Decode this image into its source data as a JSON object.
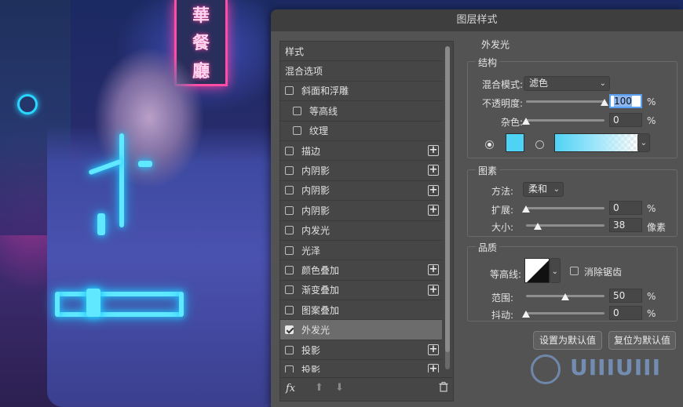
{
  "colors": {
    "dialog_bg": "#535353",
    "glow_color": "#4fd3f5",
    "gradient_start": "#4fd3f5",
    "selected_row": "#6c6c6c"
  },
  "background_photo": {
    "sign_chars": [
      "華",
      "餐",
      "廳"
    ]
  },
  "dialog": {
    "title": "图层样式",
    "styles_list": [
      {
        "label": "样式",
        "type": "header"
      },
      {
        "label": "混合选项",
        "type": "header"
      },
      {
        "label": "斜面和浮雕",
        "checkbox": true,
        "checked": false,
        "plus": false,
        "indent": 0
      },
      {
        "label": "等高线",
        "checkbox": true,
        "checked": false,
        "plus": false,
        "indent": 1
      },
      {
        "label": "纹理",
        "checkbox": true,
        "checked": false,
        "plus": false,
        "indent": 1
      },
      {
        "label": "描边",
        "checkbox": true,
        "checked": false,
        "plus": true,
        "indent": 0
      },
      {
        "label": "内阴影",
        "checkbox": true,
        "checked": false,
        "plus": true,
        "indent": 0
      },
      {
        "label": "内阴影",
        "checkbox": true,
        "checked": false,
        "plus": true,
        "indent": 0
      },
      {
        "label": "内阴影",
        "checkbox": true,
        "checked": false,
        "plus": true,
        "indent": 0
      },
      {
        "label": "内发光",
        "checkbox": true,
        "checked": false,
        "plus": false,
        "indent": 0
      },
      {
        "label": "光泽",
        "checkbox": true,
        "checked": false,
        "plus": false,
        "indent": 0
      },
      {
        "label": "颜色叠加",
        "checkbox": true,
        "checked": false,
        "plus": true,
        "indent": 0
      },
      {
        "label": "渐变叠加",
        "checkbox": true,
        "checked": false,
        "plus": true,
        "indent": 0
      },
      {
        "label": "图案叠加",
        "checkbox": true,
        "checked": false,
        "plus": false,
        "indent": 0
      },
      {
        "label": "外发光",
        "checkbox": true,
        "checked": true,
        "plus": false,
        "indent": 0,
        "selected": true
      },
      {
        "label": "投影",
        "checkbox": true,
        "checked": false,
        "plus": true,
        "indent": 0
      },
      {
        "label": "投影",
        "checkbox": true,
        "checked": false,
        "plus": true,
        "indent": 0
      }
    ],
    "footer": {
      "fx_label": "fx",
      "up_icon": "arrow-up-icon",
      "down_icon": "arrow-down-icon",
      "trash_icon": "trash-icon"
    },
    "outer_glow": {
      "title": "外发光",
      "structure": {
        "title": "结构",
        "blend_mode_label": "混合模式:",
        "blend_mode_value": "滤色",
        "opacity_label": "不透明度:",
        "opacity_value": "100",
        "opacity_fraction": 1.0,
        "noise_label": "杂色:",
        "noise_value": "0",
        "noise_fraction": 0.0,
        "unit_percent": "%"
      },
      "elements": {
        "title": "图素",
        "method_label": "方法:",
        "method_value": "柔和",
        "spread_label": "扩展:",
        "spread_value": "0",
        "spread_fraction": 0.0,
        "size_label": "大小:",
        "size_value": "38",
        "size_unit": "像素",
        "size_fraction": 0.15,
        "unit_percent": "%"
      },
      "quality": {
        "title": "品质",
        "contour_label": "等高线:",
        "antialias_label": "消除锯齿",
        "antialias_checked": false,
        "range_label": "范围:",
        "range_value": "50",
        "range_fraction": 0.5,
        "jitter_label": "抖动:",
        "jitter_value": "0",
        "jitter_fraction": 0.0,
        "unit_percent": "%"
      },
      "buttons": {
        "set_default": "设置为默认值",
        "reset_default": "复位为默认值"
      }
    }
  },
  "watermark": {
    "text": "UIIIUIII"
  }
}
